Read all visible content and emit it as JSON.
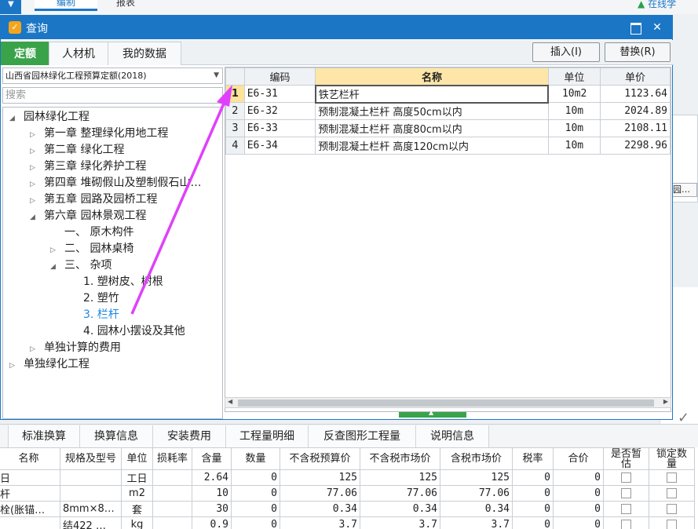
{
  "app": {
    "menu_arrow": "▼",
    "tabs": [
      "编制",
      "报表"
    ],
    "online_icon": "▲",
    "online_label": "在线学"
  },
  "dialog": {
    "title": "查询",
    "tabs": [
      "定额",
      "人材机",
      "我的数据"
    ],
    "insert_label": "插入(I)",
    "replace_label": "替换(R)"
  },
  "left": {
    "quota_library": "山西省园林绿化工程预算定额(2018)",
    "search_placeholder": "搜索",
    "tree": [
      {
        "label": "园林绿化工程",
        "toggle": "◢",
        "level": 0
      },
      {
        "label": "第一章 整理绿化用地工程",
        "toggle": "▷",
        "level": 1
      },
      {
        "label": "第二章 绿化工程",
        "toggle": "▷",
        "level": 1
      },
      {
        "label": "第三章 绿化养护工程",
        "toggle": "▷",
        "level": 1
      },
      {
        "label": "第四章 堆砌假山及塑制假石山…",
        "toggle": "▷",
        "level": 1
      },
      {
        "label": "第五章 园路及园桥工程",
        "toggle": "▷",
        "level": 1
      },
      {
        "label": "第六章 园林景观工程",
        "toggle": "◢",
        "level": 1
      },
      {
        "label": "一、 原木构件",
        "toggle": "",
        "level": 2
      },
      {
        "label": "二、 园林桌椅",
        "toggle": "▷",
        "level": 2
      },
      {
        "label": "三、 杂项",
        "toggle": "◢",
        "level": 2
      },
      {
        "label": "1. 塑树皮、树根",
        "toggle": "",
        "level": 3
      },
      {
        "label": "2. 塑竹",
        "toggle": "",
        "level": 3
      },
      {
        "label": "3. 栏杆",
        "toggle": "",
        "level": 3,
        "selected": true
      },
      {
        "label": "4. 园林小摆设及其他",
        "toggle": "",
        "level": 3
      },
      {
        "label": "单独计算的费用",
        "toggle": "▷",
        "level": 1
      },
      {
        "label": "单独绿化工程",
        "toggle": "▷",
        "level": 0
      }
    ]
  },
  "grid": {
    "headers": [
      "编码",
      "名称",
      "单位",
      "单价"
    ],
    "rows": [
      {
        "n": "1",
        "code": "E6-31",
        "name": "铁艺栏杆",
        "unit": "10m2",
        "price": "1123.64"
      },
      {
        "n": "2",
        "code": "E6-32",
        "name": "预制混凝土栏杆 高度50cm以内",
        "unit": "10m",
        "price": "2024.89"
      },
      {
        "n": "3",
        "code": "E6-33",
        "name": "预制混凝土栏杆 高度80cm以内",
        "unit": "10m",
        "price": "2108.11"
      },
      {
        "n": "4",
        "code": "E6-34",
        "name": "预制混凝土栏杆 高度120cm以内",
        "unit": "10m",
        "price": "2298.96"
      }
    ]
  },
  "background_right": {
    "button_label": "园…",
    "check_icon": "✓"
  },
  "bottom": {
    "tabs": [
      "标准换算",
      "换算信息",
      "安装费用",
      "工程量明细",
      "反查图形工程量",
      "说明信息"
    ],
    "headers": [
      "名称",
      "规格及型号",
      "单位",
      "损耗率",
      "含量",
      "数量",
      "不含税预算价",
      "不含税市场价",
      "含税市场价",
      "税率",
      "合价",
      "是否暂估",
      "锁定数量"
    ],
    "rows": [
      {
        "name": "日",
        "spec": "",
        "unit": "工日",
        "loss": "",
        "qty_per": "2.64",
        "qty": "0",
        "budget": "125",
        "market": "125",
        "market_tax": "125",
        "tax": "0",
        "total": "0"
      },
      {
        "name": "杆",
        "spec": "",
        "unit": "m2",
        "loss": "",
        "qty_per": "10",
        "qty": "0",
        "budget": "77.06",
        "market": "77.06",
        "market_tax": "77.06",
        "tax": "0",
        "total": "0"
      },
      {
        "name": "栓(胀锚…",
        "spec": "8mm×8…",
        "unit": "套",
        "loss": "",
        "qty_per": "30",
        "qty": "0",
        "budget": "0.34",
        "market": "0.34",
        "market_tax": "0.34",
        "tax": "0",
        "total": "0"
      },
      {
        "name": "",
        "spec": "结422 …",
        "unit": "kg",
        "loss": "",
        "qty_per": "0.9",
        "qty": "0",
        "budget": "3.7",
        "market": "3.7",
        "market_tax": "3.7",
        "tax": "0",
        "total": "0"
      }
    ]
  },
  "annotation": {
    "arrow_color": "#e040fb"
  }
}
